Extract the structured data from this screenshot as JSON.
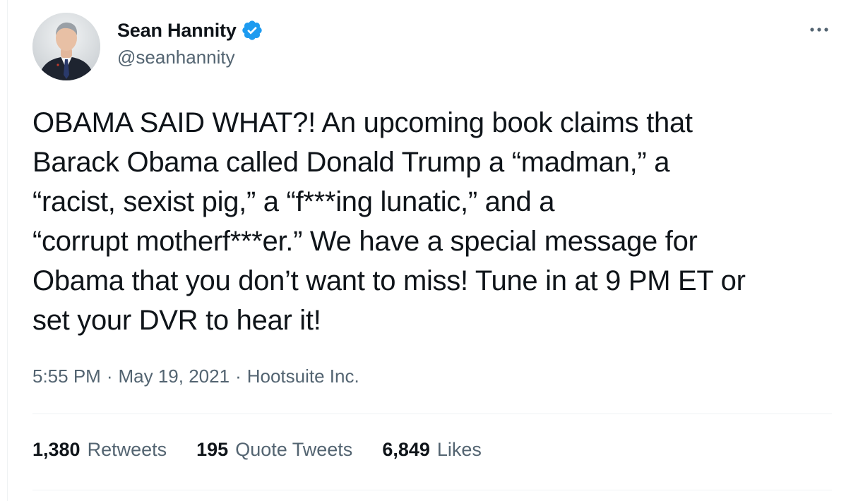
{
  "author": {
    "display_name": "Sean Hannity",
    "handle": "@seanhannity",
    "verified": true,
    "avatar_icon": "profile-photo"
  },
  "tweet": {
    "text": "OBAMA SAID WHAT?! An upcoming book claims that\nBarack Obama called Donald Trump a “madman,” a\n“racist, sexist pig,” a “f***ing lunatic,” and a\n“corrupt motherf***er.” We have a special message for\nObama that you don’t want to miss! Tune in at 9 PM ET or\nset your DVR to hear it!",
    "time": "5:55 PM",
    "date": "May 19, 2021",
    "source": "Hootsuite Inc.",
    "separator": "·"
  },
  "stats": {
    "retweets_count": "1,380",
    "retweets_label": "Retweets",
    "quote_tweets_count": "195",
    "quote_tweets_label": "Quote Tweets",
    "likes_count": "6,849",
    "likes_label": "Likes"
  },
  "icons": {
    "verified": "verified-badge-icon",
    "more": "more-options-icon"
  },
  "colors": {
    "text_primary": "#0f1419",
    "text_secondary": "#536471",
    "verified_blue": "#1d9bf0",
    "divider": "#eff3f4"
  }
}
